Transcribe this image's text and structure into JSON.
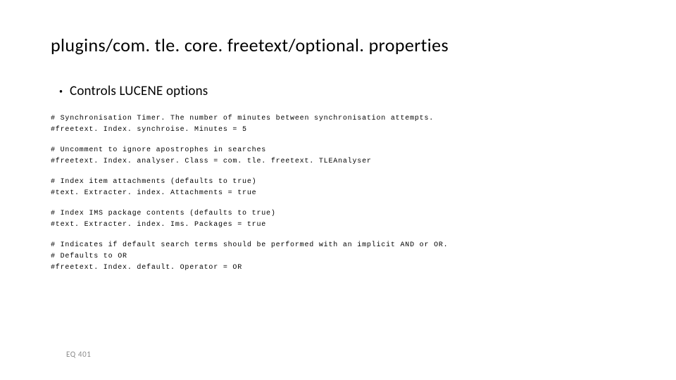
{
  "title": "plugins/com. tle. core. freetext/optional. properties",
  "bullet": "Controls LUCENE options",
  "code": {
    "l1": "# Synchronisation Timer. The number of minutes between synchronisation attempts.",
    "l2": "#freetext. Index. synchroise. Minutes = 5",
    "l3": "# Uncomment to ignore apostrophes in searches",
    "l4": "#freetext. Index. analyser. Class = com. tle. freetext. TLEAnalyser",
    "l5": "# Index item attachments (defaults to true)",
    "l6": "#text. Extracter. index. Attachments = true",
    "l7": "# Index IMS package contents (defaults to true)",
    "l8": "#text. Extracter. index. Ims. Packages = true",
    "l9": "# Indicates if default search terms should be performed with an implicit AND or OR.",
    "l10": "# Defaults to OR",
    "l11": "#freetext. Index. default. Operator = OR"
  },
  "footer": "EQ 401"
}
